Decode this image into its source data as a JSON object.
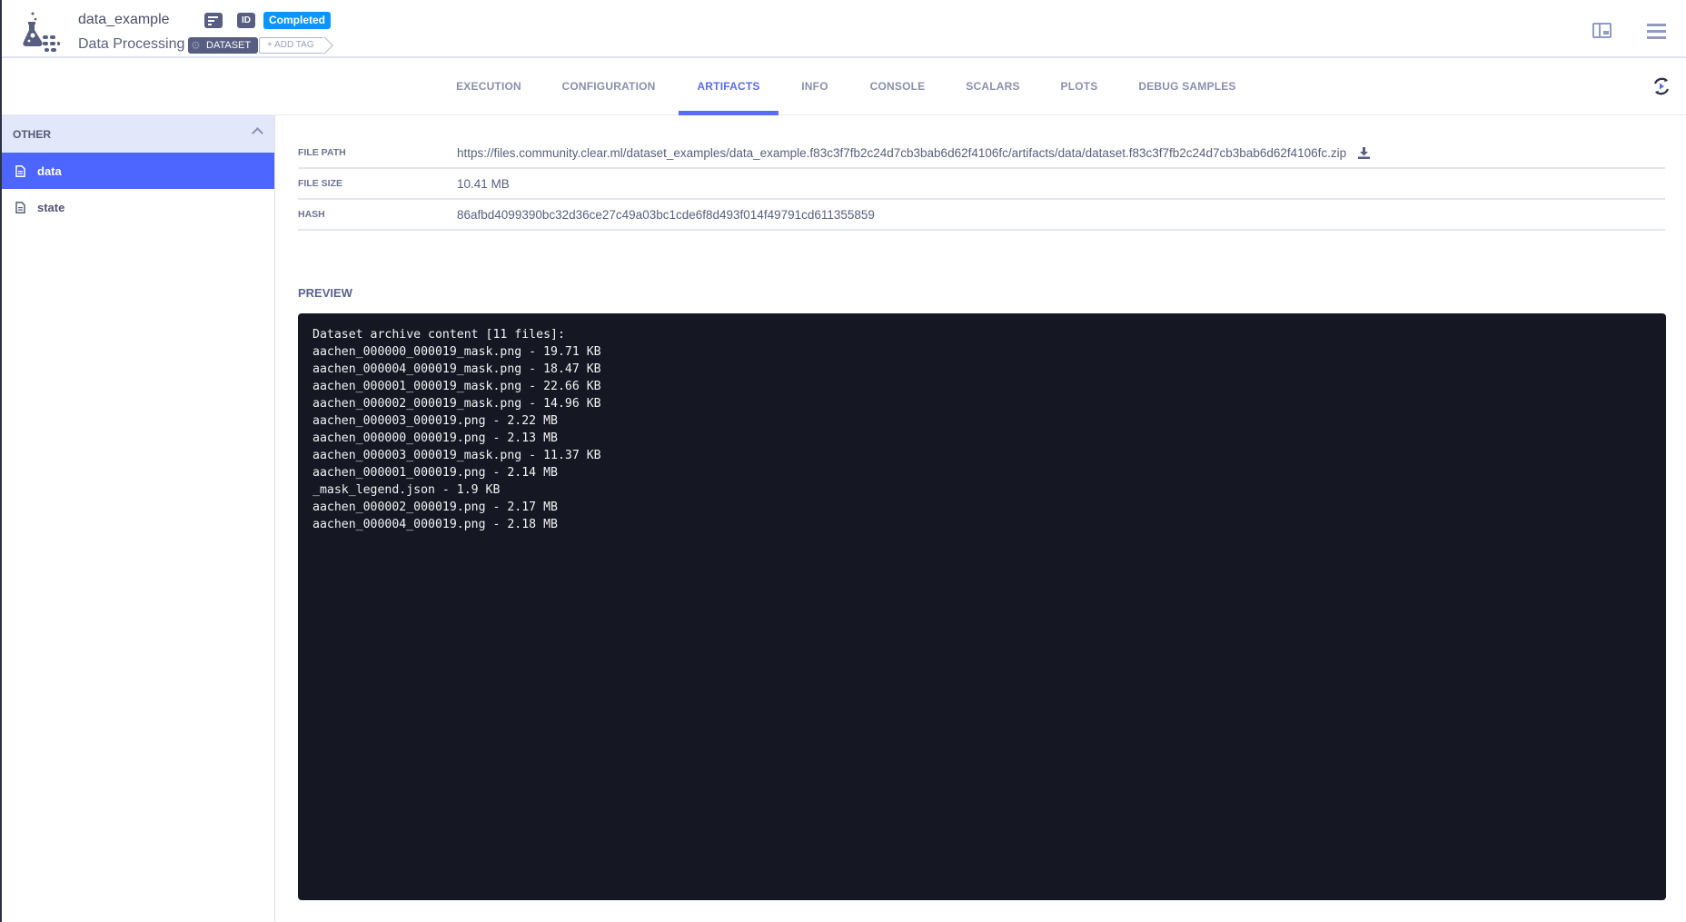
{
  "header": {
    "title": "data_example",
    "subtitle": "Data Processing",
    "id_label": "ID",
    "status": "Completed",
    "tag": "DATASET",
    "add_tag": "+ ADD TAG",
    "colors": {
      "status": "#0c95ff",
      "accent": "#5a6cf5"
    }
  },
  "tabs": [
    {
      "label": "EXECUTION",
      "active": false
    },
    {
      "label": "CONFIGURATION",
      "active": false
    },
    {
      "label": "ARTIFACTS",
      "active": true
    },
    {
      "label": "INFO",
      "active": false
    },
    {
      "label": "CONSOLE",
      "active": false
    },
    {
      "label": "SCALARS",
      "active": false
    },
    {
      "label": "PLOTS",
      "active": false
    },
    {
      "label": "DEBUG SAMPLES",
      "active": false
    }
  ],
  "sidebar": {
    "group": "OTHER",
    "items": [
      {
        "label": "data",
        "active": true,
        "icon": "file-icon"
      },
      {
        "label": "state",
        "active": false,
        "icon": "file-icon"
      }
    ]
  },
  "artifact": {
    "file_path_label": "FILE PATH",
    "file_path": "https://files.community.clear.ml/dataset_examples/data_example.f83c3f7fb2c24d7cb3bab6d62f4106fc/artifacts/data/dataset.f83c3f7fb2c24d7cb3bab6d62f4106fc.zip",
    "file_size_label": "FILE SIZE",
    "file_size": "10.41 MB",
    "hash_label": "HASH",
    "hash": "86afbd4099390bc32d36ce27c49a03bc1cde6f8d493f014f49791cd611355859"
  },
  "preview": {
    "label": "PREVIEW",
    "lines": [
      "Dataset archive content [11 files]:",
      "aachen_000000_000019_mask.png - 19.71 KB",
      "aachen_000004_000019_mask.png - 18.47 KB",
      "aachen_000001_000019_mask.png - 22.66 KB",
      "aachen_000002_000019_mask.png - 14.96 KB",
      "aachen_000003_000019.png - 2.22 MB",
      "aachen_000000_000019.png - 2.13 MB",
      "aachen_000003_000019_mask.png - 11.37 KB",
      "aachen_000001_000019.png - 2.14 MB",
      "_mask_legend.json - 1.9 KB",
      "aachen_000002_000019.png - 2.17 MB",
      "aachen_000004_000019.png - 2.18 MB"
    ]
  }
}
